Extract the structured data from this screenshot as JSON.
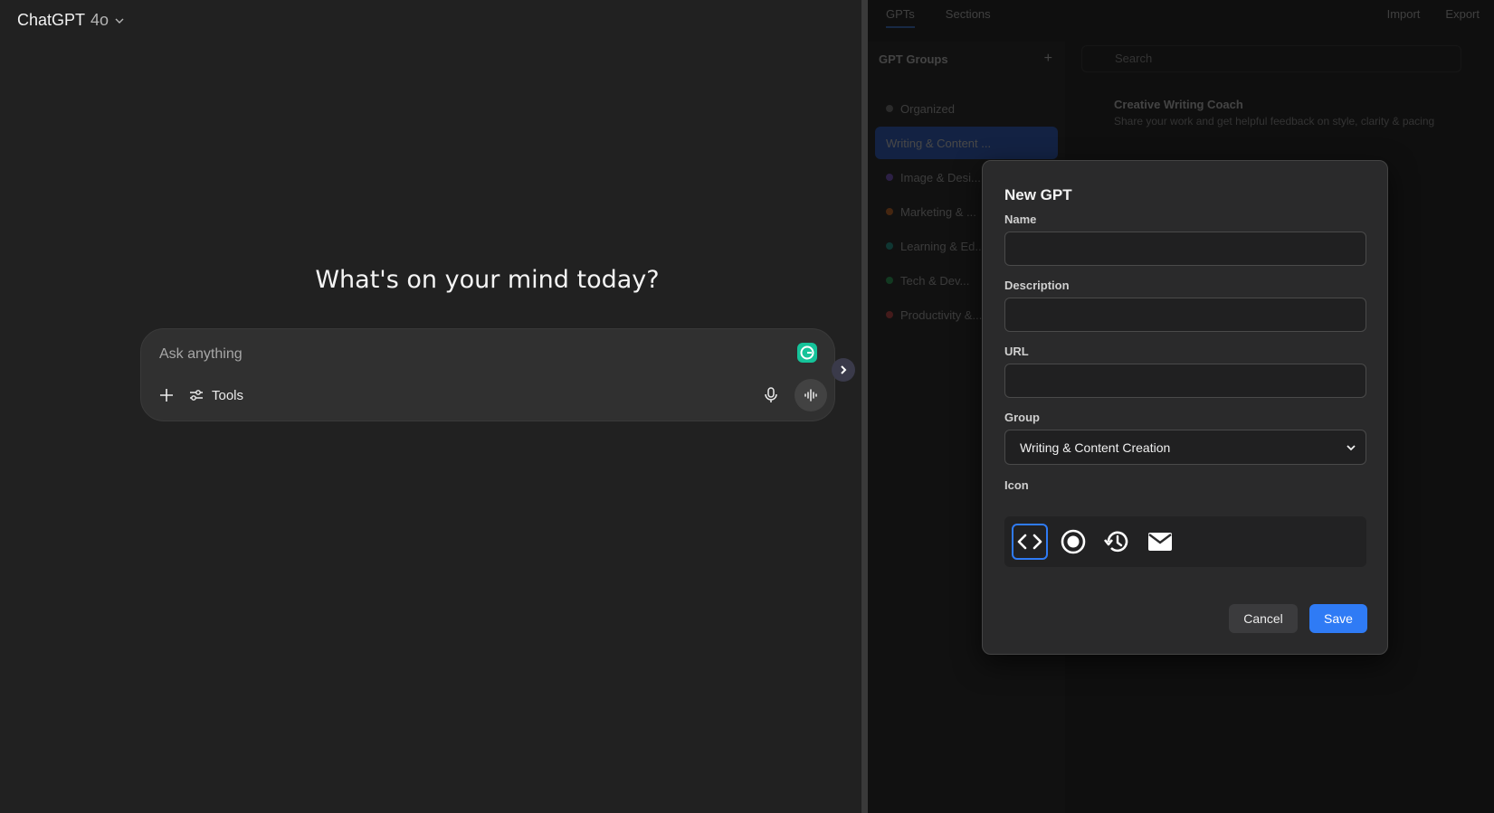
{
  "chat": {
    "model_name": "ChatGPT",
    "model_version": "4o",
    "headline": "What's on your mind today?",
    "composer_placeholder": "Ask anything",
    "tools_label": "Tools"
  },
  "side_panel": {
    "tabs": [
      "GPTs",
      "Sections"
    ],
    "actions": [
      "Import",
      "Export"
    ],
    "sidebar_title": "GPT Groups",
    "groups": [
      {
        "label": "Organized",
        "color": "#888888"
      },
      {
        "label": "Writing & Content ...",
        "color": "#3b82f6"
      },
      {
        "label": "Image & Desi...",
        "color": "#8b5cf6"
      },
      {
        "label": "Marketing & ...",
        "color": "#f97316"
      },
      {
        "label": "Learning & Ed...",
        "color": "#14b8a6"
      },
      {
        "label": "Tech & Dev...",
        "color": "#22c55e"
      },
      {
        "label": "Productivity &...",
        "color": "#ef4444"
      }
    ],
    "search_placeholder": "Search",
    "items": [
      {
        "title": "Creative Writing Coach",
        "desc": "Share your work and get helpful feedback on style, clarity & pacing"
      },
      {
        "title": "",
        "desc": ""
      },
      {
        "title": "",
        "desc": ""
      }
    ]
  },
  "modal": {
    "title": "New GPT",
    "name_label": "Name",
    "name_value": "",
    "description_label": "Description",
    "description_value": "",
    "url_label": "URL",
    "url_value": "",
    "group_label": "Group",
    "group_selected": "Writing & Content Creation",
    "icon_label": "Icon",
    "icons": [
      "code-icon",
      "record-icon",
      "history-icon",
      "mail-icon"
    ],
    "selected_icon": "code-icon",
    "cancel_label": "Cancel",
    "save_label": "Save",
    "accent_color": "#2f7bf5"
  }
}
